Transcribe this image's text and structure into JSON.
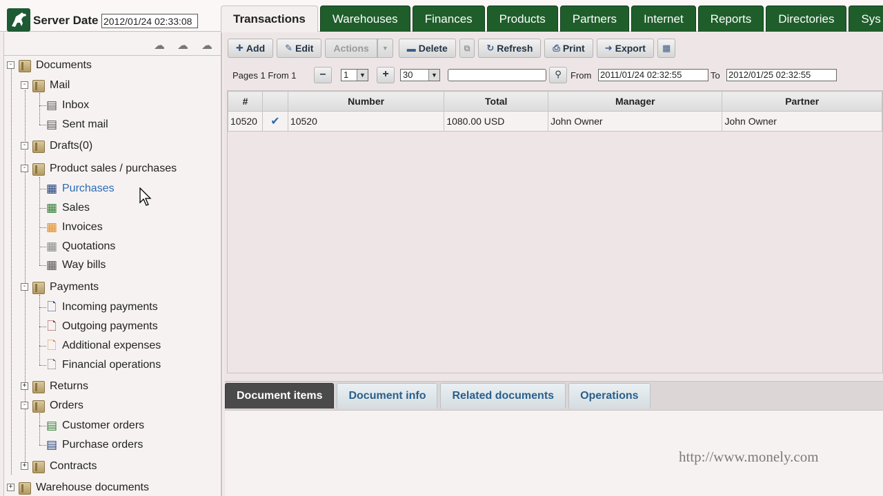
{
  "server_date": {
    "label": "Server Date",
    "value": "2012/01/24  02:33:08"
  },
  "main_tabs": [
    {
      "label": "Transactions",
      "active": true
    },
    {
      "label": "Warehouses"
    },
    {
      "label": "Finances"
    },
    {
      "label": "Products"
    },
    {
      "label": "Partners"
    },
    {
      "label": "Internet"
    },
    {
      "label": "Reports"
    },
    {
      "label": "Directories"
    },
    {
      "label": "Sys"
    }
  ],
  "left_toolbar": {
    "icons": [
      "brain-icon",
      "brain-icon",
      "brain-icon"
    ]
  },
  "tree": {
    "documents": "Documents",
    "mail": "Mail",
    "inbox": "Inbox",
    "sent_mail": "Sent mail",
    "drafts": "Drafts(0)",
    "product_sales": "Product sales / purchases",
    "purchases": "Purchases",
    "sales": "Sales",
    "invoices": "Invoices",
    "quotations": "Quotations",
    "way_bills": "Way bills",
    "payments": "Payments",
    "incoming_payments": "Incoming payments",
    "outgoing_payments": "Outgoing payments",
    "additional_expenses": "Additional expenses",
    "financial_operations": "Financial operations",
    "returns": "Returns",
    "orders": "Orders",
    "customer_orders": "Customer orders",
    "purchase_orders": "Purchase orders",
    "contracts": "Contracts",
    "warehouse_documents": "Warehouse documents"
  },
  "toolbar": {
    "add": "Add",
    "edit": "Edit",
    "actions": "Actions",
    "delete": "Delete",
    "refresh": "Refresh",
    "print": "Print",
    "export": "Export"
  },
  "pager": {
    "pages_label": "Pages 1 From 1",
    "page_value": "1",
    "page_size": "30",
    "search_value": "",
    "from_label": "From",
    "from_value": "2011/01/24  02:32:55",
    "to_label": "To",
    "to_value": "2012/01/25  02:32:55"
  },
  "grid": {
    "columns": [
      "#",
      "",
      "Number",
      "Total",
      "Manager",
      "Partner"
    ],
    "rows": [
      {
        "id": "10520",
        "checked": true,
        "number": "10520",
        "total": "1080.00 USD",
        "manager": "John  Owner",
        "partner": "John  Owner"
      }
    ]
  },
  "bottom_tabs": [
    {
      "label": "Document items",
      "active": true
    },
    {
      "label": "Document info"
    },
    {
      "label": "Related documents"
    },
    {
      "label": "Operations"
    }
  ],
  "watermark": "http://www.monely.com"
}
